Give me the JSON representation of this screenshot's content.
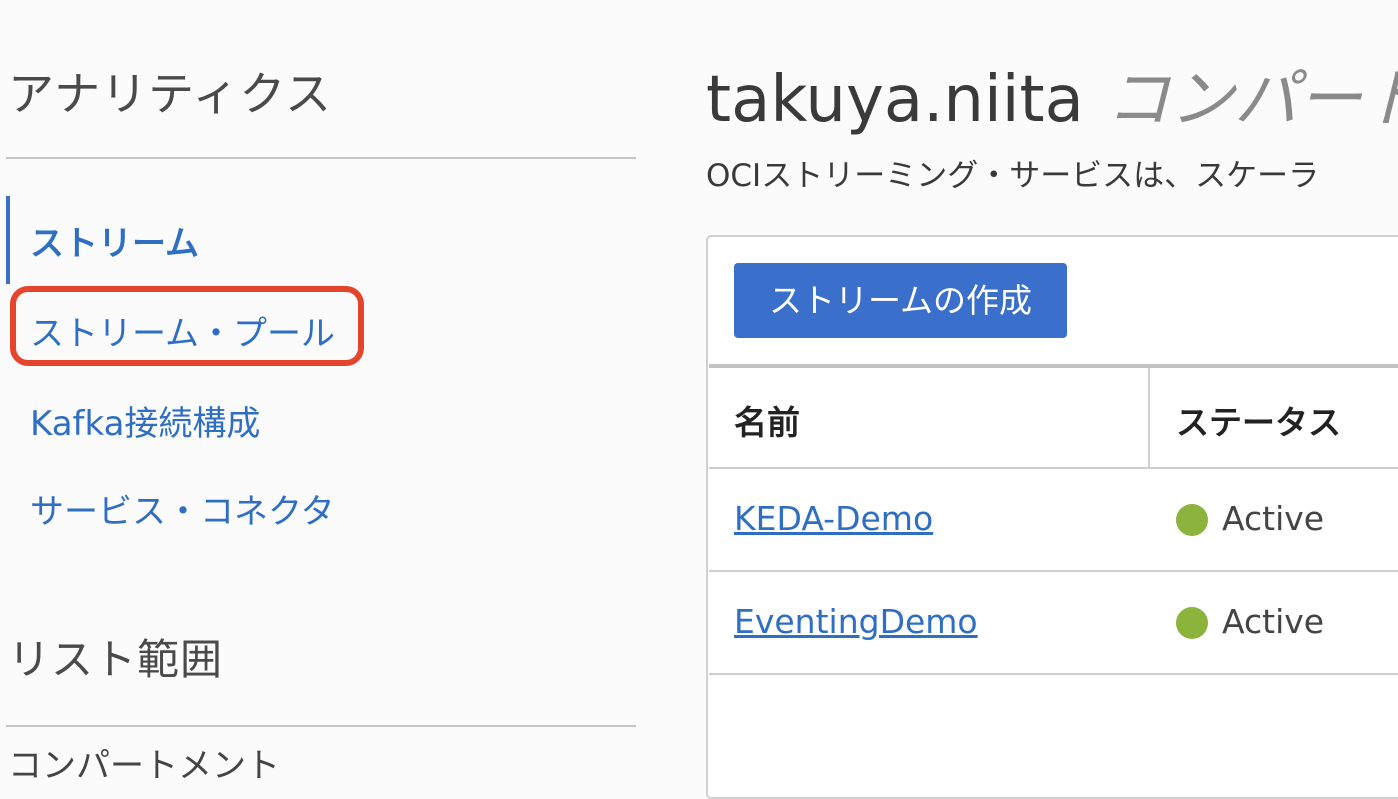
{
  "sidebar": {
    "heading": "アナリティクス",
    "items": [
      {
        "label": "ストリーム",
        "active": true
      },
      {
        "label": "ストリーム・プール",
        "active": false,
        "highlighted": true
      },
      {
        "label": "Kafka接続構成",
        "active": false
      },
      {
        "label": "サービス・コネクタ",
        "active": false
      }
    ],
    "scope_heading": "リスト範囲",
    "compartment_label": "コンパートメント"
  },
  "main": {
    "title": "takuya.niita",
    "title_suffix": "コンパート",
    "description": "OCIストリーミング・サービスは、スケーラ",
    "create_button_label": "ストリームの作成",
    "table": {
      "columns": [
        "名前",
        "ステータス"
      ],
      "rows": [
        {
          "name": "KEDA-Demo",
          "status": "Active"
        },
        {
          "name": "EventingDemo",
          "status": "Active"
        }
      ]
    }
  },
  "colors": {
    "accent": "#3a6fcc",
    "link": "#2f6fc3",
    "highlight": "#e4452c",
    "status_active": "#8cb33b"
  }
}
